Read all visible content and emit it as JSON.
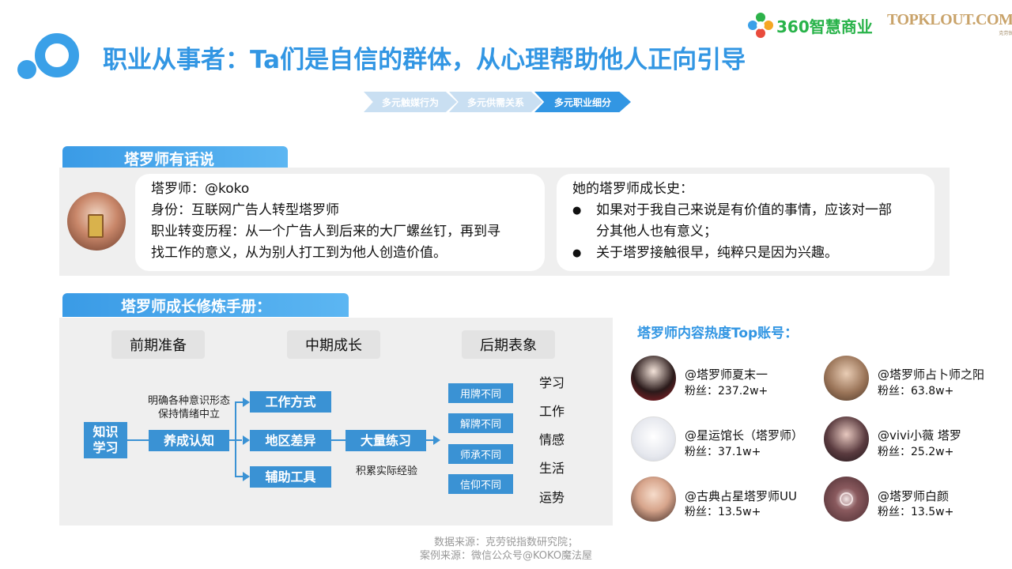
{
  "header": {
    "title": "职业从事者：Ta们是自信的群体，从心理帮助他人正向引导",
    "brand_360": "360智慧商业",
    "brand_topklout": "TOPKLOUT.COM",
    "brand_topklout_sub": "克劳锐",
    "colors": {
      "accent": "#3296e3",
      "green": "#29b34a",
      "gold": "#c9a36a"
    }
  },
  "steps": [
    "多元触媒行为",
    "多元供需关系",
    "多元职业细分"
  ],
  "profile_section": {
    "tab_title": "塔罗师有话说",
    "intro_lines": [
      "塔罗师：@koko",
      "身份：互联网广告人转型塔罗师",
      "职业转变历程：从一个广告人到后来的大厂螺丝钉，再到寻",
      "找工作的意义，从为别人打工到为他人创造价值。"
    ],
    "history_title": "她的塔罗师成长史：",
    "history_bullet_1_line_1": "如果对于我自己来说是有价值的事情，应该对一部",
    "history_bullet_1_line_2": "分其他人也有意义；",
    "history_bullet_2": "关于塔罗接触很早，纯粹只是因为兴趣。",
    "bullet_symbol": "●"
  },
  "manual_section": {
    "tab_title": "塔罗师成长修炼手册：",
    "stages": [
      "前期准备",
      "中期成长",
      "后期表象"
    ],
    "start_box": "知识\n学习",
    "cognition_note_1": "明确各种意识形态",
    "cognition_note_2": "保持情绪中立",
    "cognition_box": "养成认知",
    "branches": [
      "工作方式",
      "地区差异",
      "辅助工具"
    ],
    "practice_box": "大量练习",
    "practice_note": "积累实际经验",
    "differences": [
      "用牌不同",
      "解牌不同",
      "师承不同",
      "信仰不同"
    ],
    "aspects": [
      "学习",
      "工作",
      "情感",
      "生活",
      "运势"
    ]
  },
  "ranking": {
    "title": "塔罗师内容热度Top账号：",
    "accounts": [
      {
        "name": "@塔罗师夏末一",
        "fans": "粉丝：237.2w+"
      },
      {
        "name": "@塔罗师占卜师之阳",
        "fans": "粉丝：63.8w+"
      },
      {
        "name": "@星运馆长（塔罗师）",
        "fans": "粉丝：37.1w+"
      },
      {
        "name": "@vivi小薇 塔罗",
        "fans": "粉丝：25.2w+"
      },
      {
        "name": "@古典占星塔罗师UU",
        "fans": "粉丝：13.5w+"
      },
      {
        "name": "@塔罗师白颜",
        "fans": "粉丝：13.5w+"
      }
    ]
  },
  "footer": {
    "line1": "数据来源：克劳锐指数研究院；",
    "line2": "案例来源：微信公众号@KOKO魔法屋"
  }
}
